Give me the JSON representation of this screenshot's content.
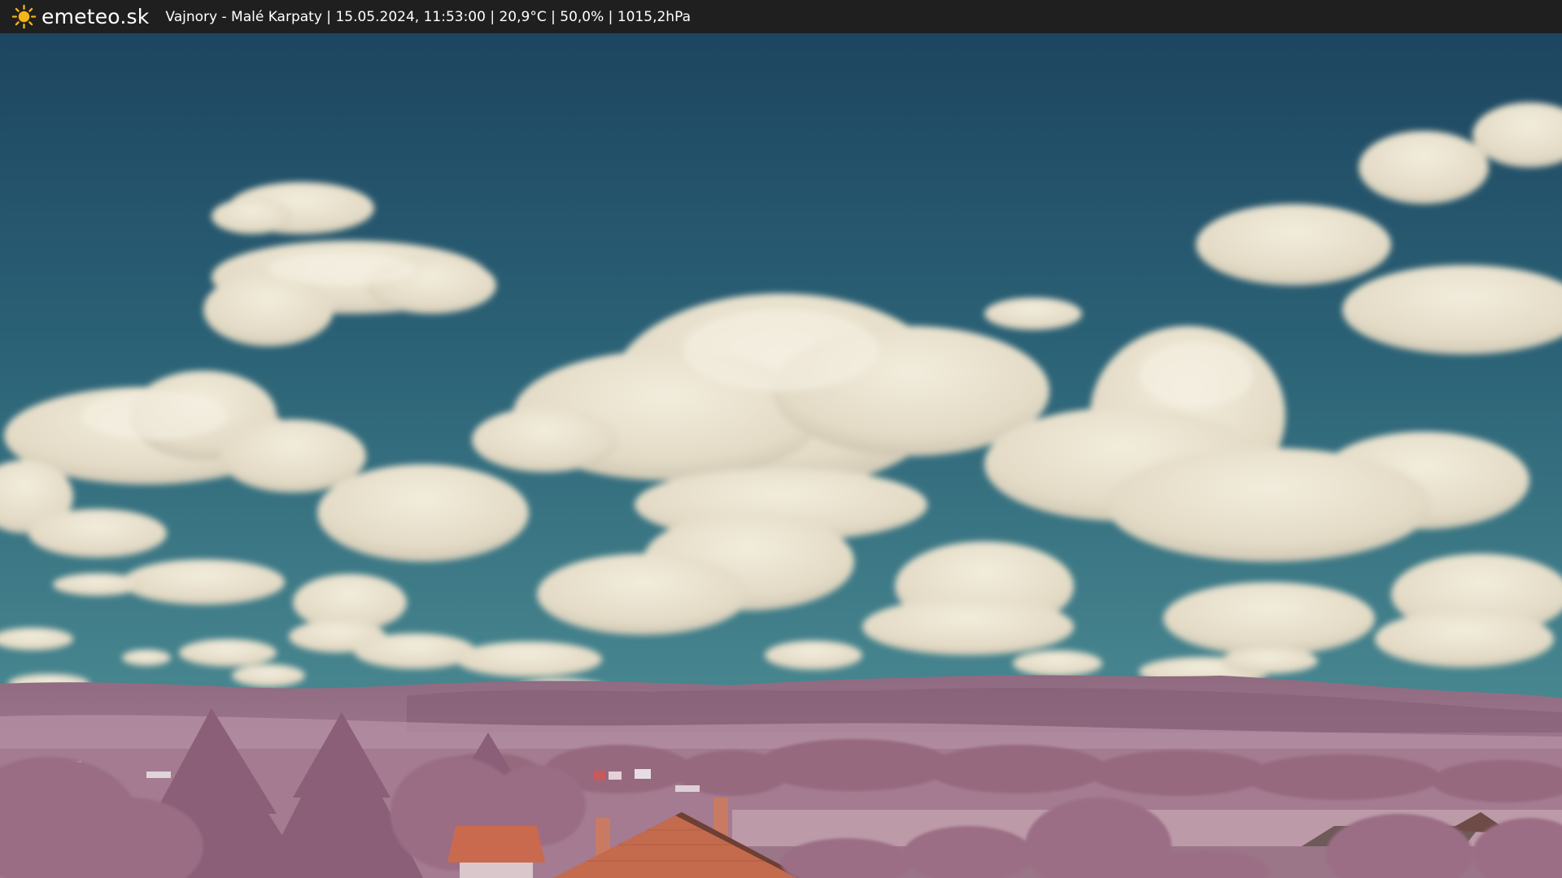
{
  "header": {
    "brand": "emeteo.sk",
    "logo_icon": "sun-icon",
    "location": "Vajnory - Malé Karpaty",
    "separator": " | ",
    "datetime": "15.05.2024, 11:53:00",
    "temperature": "20,9°C",
    "humidity": "50,0%",
    "pressure": "1015,2hPa"
  },
  "colors": {
    "bar": "#1f1f1f",
    "sun": "#f5b417",
    "sky_top": "#1d4560",
    "sky_bottom": "#3d7f8c",
    "cloud": "#e9e2cf",
    "hills": "#a77f95",
    "foliage": "#9c6f86",
    "roof": "#c96a4e"
  }
}
